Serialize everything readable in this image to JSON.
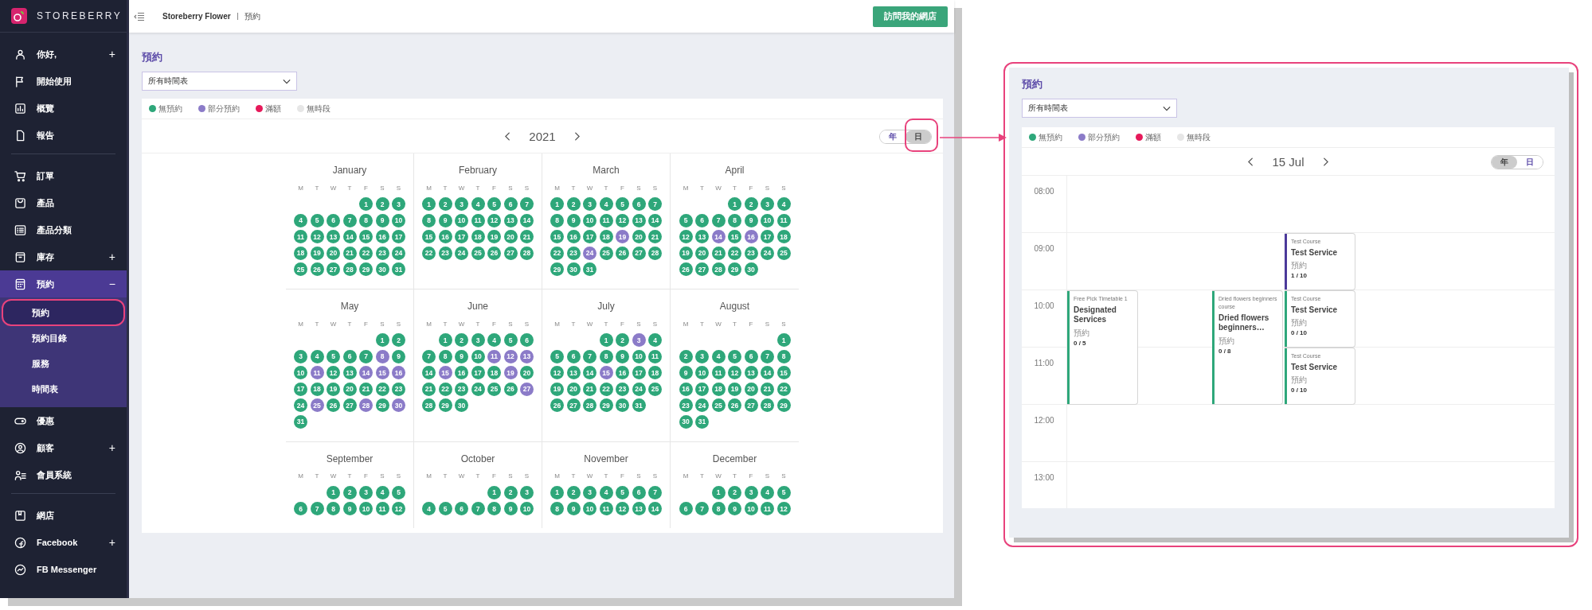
{
  "sidebar": {
    "brand": "STOREBERRY",
    "groups": [
      {
        "items": [
          {
            "label": "你好,",
            "toggle": "+",
            "expanded": false
          },
          {
            "label": "開始使用"
          },
          {
            "label": "概覽"
          },
          {
            "label": "報告"
          }
        ]
      },
      {
        "items": [
          {
            "label": "訂單"
          },
          {
            "label": "產品"
          },
          {
            "label": "產品分類"
          },
          {
            "label": "庫存",
            "toggle": "+",
            "expanded": false
          },
          {
            "label": "預約",
            "toggle": "−",
            "expanded": true,
            "children": [
              {
                "label": "預約",
                "selected": true
              },
              {
                "label": "預約目錄",
                "selected": false
              },
              {
                "label": "服務",
                "selected": false
              },
              {
                "label": "時間表",
                "selected": false
              }
            ]
          },
          {
            "label": "優惠"
          },
          {
            "label": "顧客",
            "toggle": "+",
            "expanded": false
          },
          {
            "label": "會員系統"
          }
        ]
      },
      {
        "items": [
          {
            "label": "網店"
          },
          {
            "label": "Facebook",
            "toggle": "+",
            "expanded": false
          },
          {
            "label": "FB Messenger"
          }
        ]
      }
    ]
  },
  "topbar": {
    "shop": "Storeberry Flower",
    "page": "預約",
    "button": "訪問我的網店"
  },
  "main": {
    "title": "預約",
    "select": {
      "value": "所有時間表"
    },
    "legend": [
      {
        "label": "無預約",
        "color": "#2ea77a"
      },
      {
        "label": "部分預約",
        "color": "#8b7bc8"
      },
      {
        "label": "滿額",
        "color": "#e6195a"
      },
      {
        "label": "無時段",
        "color": "#e6e6e6"
      }
    ],
    "nav": {
      "label": "2021"
    },
    "view_toggle": {
      "highlighted": true,
      "options": [
        {
          "label": "年",
          "selected": false
        },
        {
          "label": "日",
          "selected": true
        }
      ]
    },
    "months": [
      {
        "name": "January",
        "weekdays": [
          "M",
          "T",
          "W",
          "T",
          "F",
          "S",
          "S"
        ],
        "weeks": [
          [
            {
              "day": "1",
              "partial": false
            },
            {
              "day": "2",
              "partial": false
            },
            {
              "day": "3",
              "partial": false
            }
          ],
          [
            {
              "day": "4",
              "partial": false
            },
            {
              "day": "5",
              "partial": false
            },
            {
              "day": "6",
              "partial": false
            },
            {
              "day": "7",
              "partial": false
            },
            {
              "day": "8",
              "partial": false
            },
            {
              "day": "9",
              "partial": false
            },
            {
              "day": "10",
              "partial": false
            }
          ],
          [
            {
              "day": "11",
              "partial": false
            },
            {
              "day": "12",
              "partial": false
            },
            {
              "day": "13",
              "partial": false
            },
            {
              "day": "14",
              "partial": false
            },
            {
              "day": "15",
              "partial": false
            },
            {
              "day": "16",
              "partial": false
            },
            {
              "day": "17",
              "partial": false
            }
          ],
          [
            {
              "day": "18",
              "partial": false
            },
            {
              "day": "19",
              "partial": false
            },
            {
              "day": "20",
              "partial": false
            },
            {
              "day": "21",
              "partial": false
            },
            {
              "day": "22",
              "partial": false
            },
            {
              "day": "23",
              "partial": false
            },
            {
              "day": "24",
              "partial": false
            }
          ],
          [
            {
              "day": "25",
              "partial": false
            },
            {
              "day": "26",
              "partial": false
            },
            {
              "day": "27",
              "partial": false
            },
            {
              "day": "28",
              "partial": false
            },
            {
              "day": "29",
              "partial": false
            },
            {
              "day": "30",
              "partial": false
            },
            {
              "day": "31",
              "partial": false
            }
          ]
        ]
      },
      {
        "name": "February",
        "weekdays": [
          "M",
          "T",
          "W",
          "T",
          "F",
          "S",
          "S"
        ],
        "weeks": [
          [
            {
              "day": "1",
              "partial": false
            },
            {
              "day": "2",
              "partial": false
            },
            {
              "day": "3",
              "partial": false
            },
            {
              "day": "4",
              "partial": false
            },
            {
              "day": "5",
              "partial": false
            },
            {
              "day": "6",
              "partial": false
            },
            {
              "day": "7",
              "partial": false
            }
          ],
          [
            {
              "day": "8",
              "partial": false
            },
            {
              "day": "9",
              "partial": false
            },
            {
              "day": "10",
              "partial": false
            },
            {
              "day": "11",
              "partial": false
            },
            {
              "day": "12",
              "partial": false
            },
            {
              "day": "13",
              "partial": false
            },
            {
              "day": "14",
              "partial": false
            }
          ],
          [
            {
              "day": "15",
              "partial": false
            },
            {
              "day": "16",
              "partial": false
            },
            {
              "day": "17",
              "partial": false
            },
            {
              "day": "18",
              "partial": false
            },
            {
              "day": "19",
              "partial": false
            },
            {
              "day": "20",
              "partial": false
            },
            {
              "day": "21",
              "partial": false
            }
          ],
          [
            {
              "day": "22",
              "partial": false
            },
            {
              "day": "23",
              "partial": false
            },
            {
              "day": "24",
              "partial": false
            },
            {
              "day": "25",
              "partial": false
            },
            {
              "day": "26",
              "partial": false
            },
            {
              "day": "27",
              "partial": false
            },
            {
              "day": "28",
              "partial": false
            }
          ]
        ]
      },
      {
        "name": "March",
        "weekdays": [
          "M",
          "T",
          "W",
          "T",
          "F",
          "S",
          "S"
        ],
        "weeks": [
          [
            {
              "day": "1",
              "partial": false
            },
            {
              "day": "2",
              "partial": false
            },
            {
              "day": "3",
              "partial": false
            },
            {
              "day": "4",
              "partial": false
            },
            {
              "day": "5",
              "partial": false
            },
            {
              "day": "6",
              "partial": false
            },
            {
              "day": "7",
              "partial": false
            }
          ],
          [
            {
              "day": "8",
              "partial": false
            },
            {
              "day": "9",
              "partial": false
            },
            {
              "day": "10",
              "partial": false
            },
            {
              "day": "11",
              "partial": false
            },
            {
              "day": "12",
              "partial": false
            },
            {
              "day": "13",
              "partial": false
            },
            {
              "day": "14",
              "partial": false
            }
          ],
          [
            {
              "day": "15",
              "partial": false
            },
            {
              "day": "16",
              "partial": false
            },
            {
              "day": "17",
              "partial": false
            },
            {
              "day": "18",
              "partial": false
            },
            {
              "day": "19",
              "partial": true
            },
            {
              "day": "20",
              "partial": false
            },
            {
              "day": "21",
              "partial": false
            }
          ],
          [
            {
              "day": "22",
              "partial": false
            },
            {
              "day": "23",
              "partial": false
            },
            {
              "day": "24",
              "partial": true
            },
            {
              "day": "25",
              "partial": false
            },
            {
              "day": "26",
              "partial": false
            },
            {
              "day": "27",
              "partial": false
            },
            {
              "day": "28",
              "partial": false
            }
          ],
          [
            {
              "day": "29",
              "partial": false
            },
            {
              "day": "30",
              "partial": false
            },
            {
              "day": "31",
              "partial": false
            }
          ]
        ]
      },
      {
        "name": "April",
        "weekdays": [
          "M",
          "T",
          "W",
          "T",
          "F",
          "S",
          "S"
        ],
        "weeks": [
          [
            {
              "day": "1",
              "partial": false
            },
            {
              "day": "2",
              "partial": false
            },
            {
              "day": "3",
              "partial": false
            },
            {
              "day": "4",
              "partial": false
            }
          ],
          [
            {
              "day": "5",
              "partial": false
            },
            {
              "day": "6",
              "partial": false
            },
            {
              "day": "7",
              "partial": false
            },
            {
              "day": "8",
              "partial": false
            },
            {
              "day": "9",
              "partial": false
            },
            {
              "day": "10",
              "partial": false
            },
            {
              "day": "11",
              "partial": false
            }
          ],
          [
            {
              "day": "12",
              "partial": false
            },
            {
              "day": "13",
              "partial": false
            },
            {
              "day": "14",
              "partial": true
            },
            {
              "day": "15",
              "partial": false
            },
            {
              "day": "16",
              "partial": true
            },
            {
              "day": "17",
              "partial": false
            },
            {
              "day": "18",
              "partial": false
            }
          ],
          [
            {
              "day": "19",
              "partial": false
            },
            {
              "day": "20",
              "partial": false
            },
            {
              "day": "21",
              "partial": false
            },
            {
              "day": "22",
              "partial": false
            },
            {
              "day": "23",
              "partial": false
            },
            {
              "day": "24",
              "partial": false
            },
            {
              "day": "25",
              "partial": false
            }
          ],
          [
            {
              "day": "26",
              "partial": false
            },
            {
              "day": "27",
              "partial": false
            },
            {
              "day": "28",
              "partial": false
            },
            {
              "day": "29",
              "partial": false
            },
            {
              "day": "30",
              "partial": false
            }
          ]
        ]
      },
      {
        "name": "May",
        "weekdays": [
          "M",
          "T",
          "W",
          "T",
          "F",
          "S",
          "S"
        ],
        "weeks": [
          [
            {
              "day": "1",
              "partial": false
            },
            {
              "day": "2",
              "partial": false
            }
          ],
          [
            {
              "day": "3",
              "partial": false
            },
            {
              "day": "4",
              "partial": false
            },
            {
              "day": "5",
              "partial": false
            },
            {
              "day": "6",
              "partial": false
            },
            {
              "day": "7",
              "partial": false
            },
            {
              "day": "8",
              "partial": true
            },
            {
              "day": "9",
              "partial": false
            }
          ],
          [
            {
              "day": "10",
              "partial": false
            },
            {
              "day": "11",
              "partial": true
            },
            {
              "day": "12",
              "partial": false
            },
            {
              "day": "13",
              "partial": false
            },
            {
              "day": "14",
              "partial": true
            },
            {
              "day": "15",
              "partial": true
            },
            {
              "day": "16",
              "partial": true
            }
          ],
          [
            {
              "day": "17",
              "partial": false
            },
            {
              "day": "18",
              "partial": false
            },
            {
              "day": "19",
              "partial": false
            },
            {
              "day": "20",
              "partial": false
            },
            {
              "day": "21",
              "partial": false
            },
            {
              "day": "22",
              "partial": false
            },
            {
              "day": "23",
              "partial": false
            }
          ],
          [
            {
              "day": "24",
              "partial": false
            },
            {
              "day": "25",
              "partial": true
            },
            {
              "day": "26",
              "partial": false
            },
            {
              "day": "27",
              "partial": false
            },
            {
              "day": "28",
              "partial": true
            },
            {
              "day": "29",
              "partial": false
            },
            {
              "day": "30",
              "partial": true
            }
          ],
          [
            {
              "day": "31",
              "partial": false
            }
          ]
        ]
      },
      {
        "name": "June",
        "weekdays": [
          "M",
          "T",
          "W",
          "T",
          "F",
          "S",
          "S"
        ],
        "weeks": [
          [
            {
              "day": "1",
              "partial": false
            },
            {
              "day": "2",
              "partial": false
            },
            {
              "day": "3",
              "partial": false
            },
            {
              "day": "4",
              "partial": false
            },
            {
              "day": "5",
              "partial": false
            },
            {
              "day": "6",
              "partial": false
            }
          ],
          [
            {
              "day": "7",
              "partial": false
            },
            {
              "day": "8",
              "partial": false
            },
            {
              "day": "9",
              "partial": false
            },
            {
              "day": "10",
              "partial": false
            },
            {
              "day": "11",
              "partial": true
            },
            {
              "day": "12",
              "partial": true
            },
            {
              "day": "13",
              "partial": true
            }
          ],
          [
            {
              "day": "14",
              "partial": false
            },
            {
              "day": "15",
              "partial": true
            },
            {
              "day": "16",
              "partial": false
            },
            {
              "day": "17",
              "partial": false
            },
            {
              "day": "18",
              "partial": false
            },
            {
              "day": "19",
              "partial": true
            },
            {
              "day": "20",
              "partial": false
            }
          ],
          [
            {
              "day": "21",
              "partial": false
            },
            {
              "day": "22",
              "partial": false
            },
            {
              "day": "23",
              "partial": false
            },
            {
              "day": "24",
              "partial": false
            },
            {
              "day": "25",
              "partial": false
            },
            {
              "day": "26",
              "partial": false
            },
            {
              "day": "27",
              "partial": true
            }
          ],
          [
            {
              "day": "28",
              "partial": false
            },
            {
              "day": "29",
              "partial": false
            },
            {
              "day": "30",
              "partial": false
            }
          ]
        ]
      },
      {
        "name": "July",
        "weekdays": [
          "M",
          "T",
          "W",
          "T",
          "F",
          "S",
          "S"
        ],
        "weeks": [
          [
            {
              "day": "1",
              "partial": false
            },
            {
              "day": "2",
              "partial": false
            },
            {
              "day": "3",
              "partial": true
            },
            {
              "day": "4",
              "partial": false
            }
          ],
          [
            {
              "day": "5",
              "partial": false
            },
            {
              "day": "6",
              "partial": false
            },
            {
              "day": "7",
              "partial": false
            },
            {
              "day": "8",
              "partial": false
            },
            {
              "day": "9",
              "partial": false
            },
            {
              "day": "10",
              "partial": false
            },
            {
              "day": "11",
              "partial": false
            }
          ],
          [
            {
              "day": "12",
              "partial": false
            },
            {
              "day": "13",
              "partial": false
            },
            {
              "day": "14",
              "partial": false
            },
            {
              "day": "15",
              "partial": true
            },
            {
              "day": "16",
              "partial": false
            },
            {
              "day": "17",
              "partial": false
            },
            {
              "day": "18",
              "partial": false
            }
          ],
          [
            {
              "day": "19",
              "partial": false
            },
            {
              "day": "20",
              "partial": false
            },
            {
              "day": "21",
              "partial": false
            },
            {
              "day": "22",
              "partial": false
            },
            {
              "day": "23",
              "partial": false
            },
            {
              "day": "24",
              "partial": false
            },
            {
              "day": "25",
              "partial": false
            }
          ],
          [
            {
              "day": "26",
              "partial": false
            },
            {
              "day": "27",
              "partial": false
            },
            {
              "day": "28",
              "partial": false
            },
            {
              "day": "29",
              "partial": false
            },
            {
              "day": "30",
              "partial": false
            },
            {
              "day": "31",
              "partial": false
            }
          ]
        ]
      },
      {
        "name": "August",
        "weekdays": [
          "M",
          "T",
          "W",
          "T",
          "F",
          "S",
          "S"
        ],
        "weeks": [
          [
            {
              "day": "1",
              "partial": false
            }
          ],
          [
            {
              "day": "2",
              "partial": false
            },
            {
              "day": "3",
              "partial": false
            },
            {
              "day": "4",
              "partial": false
            },
            {
              "day": "5",
              "partial": false
            },
            {
              "day": "6",
              "partial": false
            },
            {
              "day": "7",
              "partial": false
            },
            {
              "day": "8",
              "partial": false
            }
          ],
          [
            {
              "day": "9",
              "partial": false
            },
            {
              "day": "10",
              "partial": false
            },
            {
              "day": "11",
              "partial": false
            },
            {
              "day": "12",
              "partial": false
            },
            {
              "day": "13",
              "partial": false
            },
            {
              "day": "14",
              "partial": false
            },
            {
              "day": "15",
              "partial": false
            }
          ],
          [
            {
              "day": "16",
              "partial": false
            },
            {
              "day": "17",
              "partial": false
            },
            {
              "day": "18",
              "partial": false
            },
            {
              "day": "19",
              "partial": false
            },
            {
              "day": "20",
              "partial": false
            },
            {
              "day": "21",
              "partial": false
            },
            {
              "day": "22",
              "partial": false
            }
          ],
          [
            {
              "day": "23",
              "partial": false
            },
            {
              "day": "24",
              "partial": false
            },
            {
              "day": "25",
              "partial": false
            },
            {
              "day": "26",
              "partial": false
            },
            {
              "day": "27",
              "partial": false
            },
            {
              "day": "28",
              "partial": false
            },
            {
              "day": "29",
              "partial": false
            }
          ],
          [
            {
              "day": "30",
              "partial": false
            },
            {
              "day": "31",
              "partial": false
            }
          ]
        ]
      },
      {
        "name": "September",
        "weekdays": [
          "M",
          "T",
          "W",
          "T",
          "F",
          "S",
          "S"
        ],
        "weeks": [
          [
            {
              "day": "1",
              "partial": false
            },
            {
              "day": "2",
              "partial": false
            },
            {
              "day": "3",
              "partial": false
            },
            {
              "day": "4",
              "partial": false
            },
            {
              "day": "5",
              "partial": false
            }
          ],
          [
            {
              "day": "6",
              "partial": false
            },
            {
              "day": "7",
              "partial": false
            },
            {
              "day": "8",
              "partial": false
            },
            {
              "day": "9",
              "partial": false
            },
            {
              "day": "10",
              "partial": false
            },
            {
              "day": "11",
              "partial": false
            },
            {
              "day": "12",
              "partial": false
            }
          ]
        ]
      },
      {
        "name": "October",
        "weekdays": [
          "M",
          "T",
          "W",
          "T",
          "F",
          "S",
          "S"
        ],
        "weeks": [
          [
            {
              "day": "1",
              "partial": false
            },
            {
              "day": "2",
              "partial": false
            },
            {
              "day": "3",
              "partial": false
            }
          ],
          [
            {
              "day": "4",
              "partial": false
            },
            {
              "day": "5",
              "partial": false
            },
            {
              "day": "6",
              "partial": false
            },
            {
              "day": "7",
              "partial": false
            },
            {
              "day": "8",
              "partial": false
            },
            {
              "day": "9",
              "partial": false
            },
            {
              "day": "10",
              "partial": false
            }
          ]
        ]
      },
      {
        "name": "November",
        "weekdays": [
          "M",
          "T",
          "W",
          "T",
          "F",
          "S",
          "S"
        ],
        "weeks": [
          [
            {
              "day": "1",
              "partial": false
            },
            {
              "day": "2",
              "partial": false
            },
            {
              "day": "3",
              "partial": false
            },
            {
              "day": "4",
              "partial": false
            },
            {
              "day": "5",
              "partial": false
            },
            {
              "day": "6",
              "partial": false
            },
            {
              "day": "7",
              "partial": false
            }
          ],
          [
            {
              "day": "8",
              "partial": false
            },
            {
              "day": "9",
              "partial": false
            },
            {
              "day": "10",
              "partial": false
            },
            {
              "day": "11",
              "partial": false
            },
            {
              "day": "12",
              "partial": false
            },
            {
              "day": "13",
              "partial": false
            },
            {
              "day": "14",
              "partial": false
            }
          ]
        ]
      },
      {
        "name": "December",
        "weekdays": [
          "M",
          "T",
          "W",
          "T",
          "F",
          "S",
          "S"
        ],
        "weeks": [
          [
            {
              "day": "1",
              "partial": false
            },
            {
              "day": "2",
              "partial": false
            },
            {
              "day": "3",
              "partial": false
            },
            {
              "day": "4",
              "partial": false
            },
            {
              "day": "5",
              "partial": false
            }
          ],
          [
            {
              "day": "6",
              "partial": false
            },
            {
              "day": "7",
              "partial": false
            },
            {
              "day": "8",
              "partial": false
            },
            {
              "day": "9",
              "partial": false
            },
            {
              "day": "10",
              "partial": false
            },
            {
              "day": "11",
              "partial": false
            },
            {
              "day": "12",
              "partial": false
            }
          ]
        ]
      }
    ]
  },
  "day_view": {
    "title": "預約",
    "select": {
      "value": "所有時間表"
    },
    "legend": [
      {
        "label": "無預約",
        "color": "#2ea77a"
      },
      {
        "label": "部分預約",
        "color": "#8b7bc8"
      },
      {
        "label": "滿額",
        "color": "#e6195a"
      },
      {
        "label": "無時段",
        "color": "#e6e6e6"
      }
    ],
    "nav": {
      "label": "15 Jul"
    },
    "view_toggle": {
      "options": [
        {
          "label": "年",
          "selected": true
        },
        {
          "label": "日",
          "selected": false
        }
      ]
    },
    "hours": [
      "08:00",
      "09:00",
      "10:00",
      "11:00",
      "12:00",
      "13:00"
    ],
    "lanes": [
      {
        "kind": "events",
        "blocks": [
          {
            "kind": "gap"
          },
          {
            "kind": "gap"
          },
          {
            "kind": "long-event",
            "color": "#2ea77a",
            "course": "Free Pick Timetable 1",
            "service": "Designated Services",
            "label": "預約",
            "count": "0 / 5"
          }
        ]
      },
      {
        "kind": "empty"
      },
      {
        "kind": "events",
        "blocks": [
          {
            "kind": "gap"
          },
          {
            "kind": "gap"
          },
          {
            "kind": "long-event",
            "color": "#2ea77a",
            "course": "Dried flowers beginners course",
            "service": "Dried flowers beginners…",
            "label": "預約",
            "count": "0 / 8"
          }
        ]
      },
      {
        "kind": "events",
        "blocks": [
          {
            "kind": "gap"
          },
          {
            "kind": "event",
            "color": "#4b3a9a",
            "course": "Test Course",
            "service": "Test Service",
            "label": "預約",
            "count": "1 / 10"
          },
          {
            "kind": "event",
            "color": "#2ea77a",
            "course": "Test Course",
            "service": "Test Service",
            "label": "預約",
            "count": "0 / 10"
          },
          {
            "kind": "event",
            "color": "#2ea77a",
            "course": "Test Course",
            "service": "Test Service",
            "label": "預約",
            "count": "0 / 10"
          }
        ]
      }
    ]
  }
}
